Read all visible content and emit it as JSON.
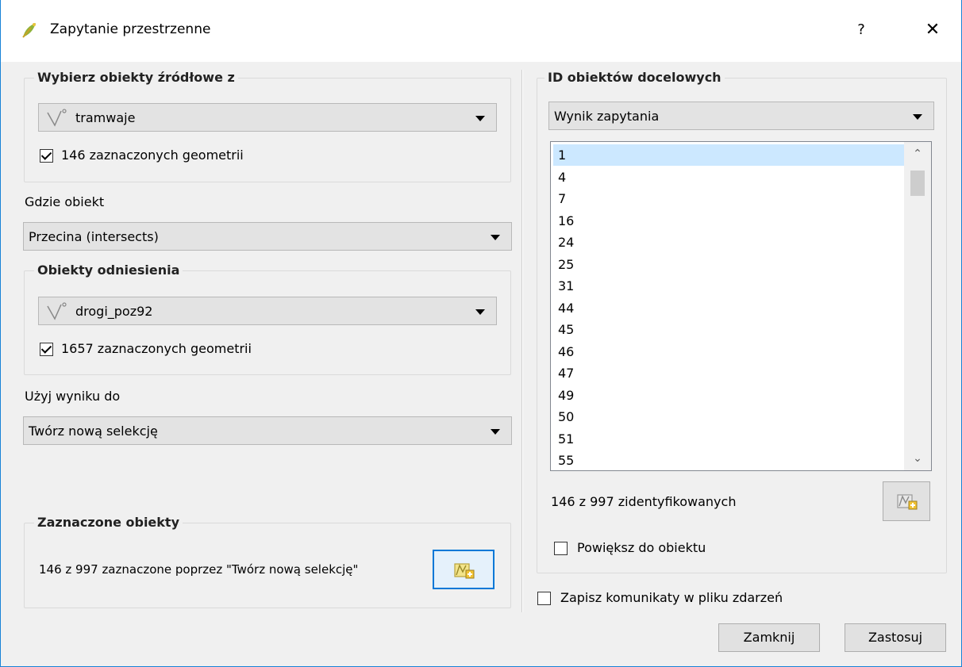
{
  "window": {
    "title": "Zapytanie przestrzenne",
    "help_label": "?",
    "close_label": "✕"
  },
  "source": {
    "group_title": "Wybierz obiekty źródłowe z",
    "layer": "tramwaje",
    "selected_only_checked": true,
    "selected_only_label": "146 zaznaczonych geometrii"
  },
  "operation": {
    "label": "Gdzie obiekt",
    "value": "Przecina (intersects)"
  },
  "reference": {
    "group_title": "Obiekty odniesienia",
    "layer": "drogi_poz92",
    "selected_only_checked": true,
    "selected_only_label": "1657 zaznaczonych geometrii"
  },
  "result_use": {
    "label": "Użyj wyniku do",
    "value": "Twórz nową selekcję"
  },
  "selected_features": {
    "group_title": "Zaznaczone obiekty",
    "text": "146 z 997 zaznaczone poprzez \"Twórz nową selekcję\""
  },
  "target_ids": {
    "group_title": "ID obiektów docelowych",
    "source_value": "Wynik zapytania",
    "ids": [
      "1",
      "4",
      "7",
      "16",
      "24",
      "25",
      "31",
      "44",
      "45",
      "46",
      "47",
      "49",
      "50",
      "51",
      "55"
    ],
    "selected_index": 0,
    "identified_text": "146 z 997 zidentyfikowanych",
    "zoom_checked": false,
    "zoom_label": "Powiększ do obiektu"
  },
  "log": {
    "checked": false,
    "label": "Zapisz komunikaty w pliku zdarzeń"
  },
  "buttons": {
    "close": "Zamknij",
    "apply": "Zastosuj"
  },
  "colors": {
    "accent": "#0078d7",
    "selection": "#cce8ff",
    "dialog_bg": "#f0f0f0"
  }
}
